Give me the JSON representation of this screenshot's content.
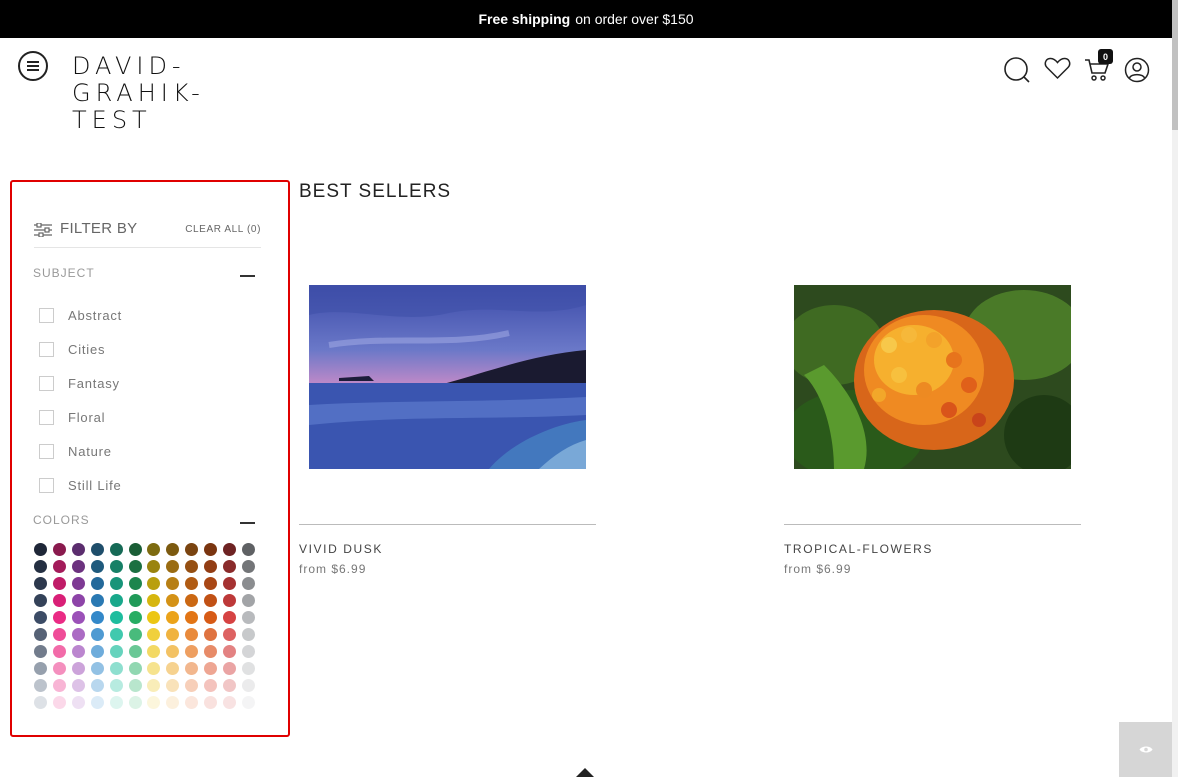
{
  "promo": {
    "bold": "Free shipping",
    "rest": "on order over $150"
  },
  "header": {
    "logo_line1": "DAVID-",
    "logo_line2": "GRAHIK-",
    "logo_line3": "TEST",
    "cart_count": "0",
    "icons": [
      "menu-icon",
      "search-icon",
      "heart-icon",
      "cart-icon",
      "user-icon"
    ]
  },
  "filter": {
    "title": "FILTER BY",
    "clear_all": "CLEAR ALL (0)",
    "subject_title": "SUBJECT",
    "subjects": [
      "Abstract",
      "Cities",
      "Fantasy",
      "Floral",
      "Nature",
      "Still Life"
    ],
    "colors_title": "COLORS",
    "color_rows": [
      [
        "#1f2738",
        "#8a1a4e",
        "#5b2d6e",
        "#1f4e6b",
        "#166a56",
        "#1a5e36",
        "#7d6b10",
        "#7c5a10",
        "#7a4410",
        "#7a3510",
        "#6e2323",
        "#5f6164"
      ],
      [
        "#242f42",
        "#a31b5a",
        "#6c327f",
        "#1f5a7d",
        "#168066",
        "#1b7041",
        "#9a840f",
        "#9a6c12",
        "#954f12",
        "#923d14",
        "#8a2b2b",
        "#737578"
      ],
      [
        "#2c384d",
        "#c01c68",
        "#7e3a94",
        "#24699a",
        "#179479",
        "#1d854d",
        "#b99f0f",
        "#b77f14",
        "#b05b13",
        "#a94715",
        "#a53232",
        "#8b8d90"
      ],
      [
        "#344259",
        "#d91f77",
        "#8d44a8",
        "#2a79b3",
        "#19a88b",
        "#209a58",
        "#d6b60f",
        "#d49216",
        "#cb6813",
        "#c15115",
        "#bd3939",
        "#a2a4a7"
      ],
      [
        "#3c4c66",
        "#ea2b85",
        "#9b51b8",
        "#3388c9",
        "#1ebd9e",
        "#27ad63",
        "#ecc613",
        "#eba31a",
        "#e27515",
        "#d75b16",
        "#d64343",
        "#b8babd"
      ],
      [
        "#566276",
        "#ef4c98",
        "#ab6bc4",
        "#4f9ad2",
        "#40c9ae",
        "#48bb7c",
        "#f0d03c",
        "#f0b33f",
        "#e98a3b",
        "#df7340",
        "#dd6262",
        "#c7c9cb"
      ],
      [
        "#727c8c",
        "#f26ba9",
        "#bb86cf",
        "#6eacdb",
        "#66d3bd",
        "#6ac896",
        "#f3d964",
        "#f3c264",
        "#ee9f61",
        "#e78b68",
        "#e38282",
        "#d4d5d7"
      ],
      [
        "#96a0ad",
        "#f48fbe",
        "#cca3da",
        "#92c1e4",
        "#8edfcf",
        "#91d7b1",
        "#f6e38e",
        "#f6d28f",
        "#f2b78e",
        "#eea693",
        "#eaa4a4",
        "#e0e1e2"
      ],
      [
        "#bcc3cc",
        "#f8b5d5",
        "#ddc2e7",
        "#b8d7ee",
        "#b7ebe0",
        "#b8e6cd",
        "#f9edb8",
        "#f9e2b9",
        "#f7cfb9",
        "#f4c3bd",
        "#f1c6c6",
        "#ebebec"
      ],
      [
        "#dde1e6",
        "#fbd8e9",
        "#eee0f3",
        "#dbebf7",
        "#ddf5ef",
        "#dcf3e6",
        "#fcf6dc",
        "#fcf0dd",
        "#fbe6dc",
        "#f9e1de",
        "#f8e2e2",
        "#f4f4f5"
      ]
    ]
  },
  "main": {
    "title": "BEST SELLERS",
    "products": [
      {
        "name": "VIVID DUSK",
        "price": "from $6.99",
        "image": "dusk-beach-photo"
      },
      {
        "name": "TROPICAL-FLOWERS",
        "price": "from $6.99",
        "image": "orange-flowers-photo"
      }
    ]
  },
  "colors": {
    "accent_border": "#e00000",
    "topbar": "#000000"
  }
}
